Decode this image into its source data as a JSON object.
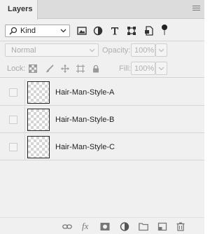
{
  "panel": {
    "tab_label": "Layers",
    "menu_icon": "panel-menu-icon"
  },
  "filter": {
    "kind_label": "Kind",
    "search_icon": "search-icon",
    "icons": [
      "image-filter-icon",
      "adjustment-filter-icon",
      "type-filter-icon",
      "shape-filter-icon",
      "smart-object-filter-icon",
      "filter-toggle-icon"
    ]
  },
  "blend": {
    "mode": "Normal",
    "opacity_label": "Opacity:",
    "opacity_value": "100%"
  },
  "lock": {
    "label": "Lock:",
    "icons": [
      "lock-transparent-icon",
      "lock-pixels-icon",
      "lock-position-icon",
      "lock-artboard-icon",
      "lock-all-icon"
    ],
    "fill_label": "Fill:",
    "fill_value": "100%"
  },
  "layers": [
    {
      "name": "Hair-Man-Style-A"
    },
    {
      "name": "Hair-Man-Style-B"
    },
    {
      "name": "Hair-Man-Style-C"
    }
  ],
  "toolbar": {
    "icons": [
      "link-layers-icon",
      "layer-style-icon",
      "layer-mask-icon",
      "adjustment-layer-icon",
      "group-folder-icon",
      "new-layer-icon",
      "trash-icon"
    ],
    "fx_label": "fx"
  },
  "colors": {
    "panel_bg": "#f0f0f0",
    "tab_bar_bg": "#dcdcdc",
    "disabled_text": "#b0b0b0"
  }
}
